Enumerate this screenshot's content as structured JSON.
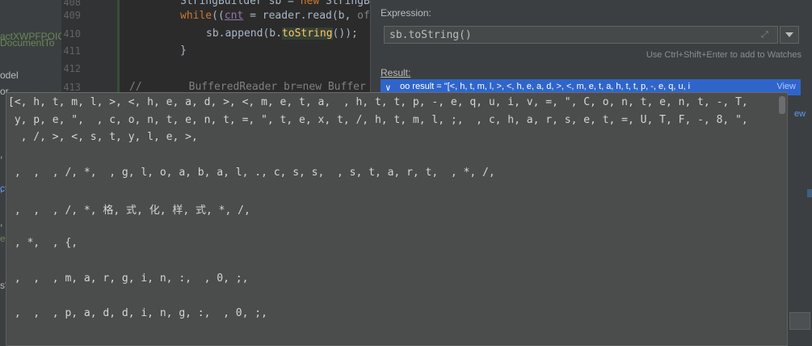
{
  "project_tree": {
    "items": [
      {
        "text": "actXWPFPOIC",
        "color": "#6a8759"
      },
      {
        "text": "DocumentTo",
        "color": "#6a8759"
      },
      {
        "text": "odel",
        "color": "#bbbbbb"
      },
      {
        "text": "or",
        "color": "#bbbbbb"
      }
    ],
    "side_glyphs": [
      ",",
      ",",
      "ct",
      ",",
      ",",
      "e",
      ",",
      ",",
      "s'",
      ",",
      ","
    ]
  },
  "editor": {
    "line_numbers": [
      "408",
      "409",
      "410",
      "411",
      "412",
      "413"
    ],
    "line_408": {
      "a": "StringBuilder sb = ",
      "kw": "new",
      "b": " StringB"
    },
    "line_409": {
      "kw": "while",
      "a": "((",
      "var": "cnt",
      "b": " = reader.read(b, ",
      "c": "of"
    },
    "line_410": {
      "a": "sb.append(b.",
      "fn": "toString",
      "b": "());"
    },
    "line_411": "}",
    "line_413": {
      "cmt1": "//",
      "cmt2": "BufferedReader br=new Buffer"
    }
  },
  "dialog": {
    "expression_label": "Expression:",
    "expression_value": "sb.toString()",
    "hint": "Use Ctrl+Shift+Enter to add to Watches",
    "result_label": "Result:",
    "result_text": "oo result = \"[<, h, t, m, l, >, <, h, e, a, d, >, <, m, e, t, a,   h, t, t, p, -, e, q, u, i",
    "result_view": "View",
    "side_link": "ew"
  },
  "popup": {
    "lines": [
      "[<, h, t, m, l, >, <, h, e, a, d, >, <, m, e, t, a,  , h, t, t, p, -, e, q, u, i, v, =, \", C, o, n, t, e, n, t, -, T,",
      " y, p, e, \",  , c, o, n, t, e, n, t, =, \", t, e, x, t, /, h, t, m, l, ;,  , c, h, a, r, s, e, t, =, U, T, F, -, 8, \",",
      "  , /, >, <, s, t, y, l, e, >,",
      "",
      " ,  ,  , /, *,  , g, l, o, a, b, a, l, ., c, s, s,  , s, t, a, r, t,  , *, /,",
      "",
      " ,  ,  , /, *, 格, 式, 化, 样, 式, *, /,",
      "",
      " , *,  , {,",
      "",
      " ,  ,  , m, a, r, g, i, n, :,  , 0, ;,",
      "",
      " ,  ,  , p, a, d, d, i, n, g, :,  , 0, ;,",
      ""
    ]
  }
}
